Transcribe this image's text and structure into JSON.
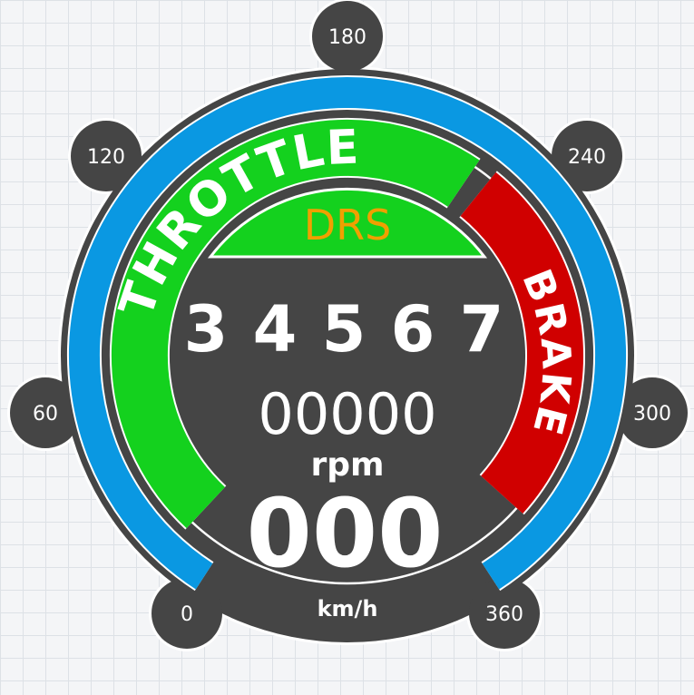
{
  "colors": {
    "body": "#454545",
    "speed_arc": "#0a98e2",
    "throttle": "#14d11e",
    "brake": "#d00000",
    "drs_text": "#f0a000",
    "text": "#ffffff"
  },
  "speed_scale": {
    "unit": "km/h",
    "ticks": [
      "0",
      "60",
      "120",
      "180",
      "240",
      "300",
      "360"
    ],
    "value": 0
  },
  "throttle": {
    "label": "THROTTLE",
    "level": 1.0
  },
  "brake": {
    "label": "BRAKE",
    "level": 1.0
  },
  "drs": {
    "label": "DRS",
    "active": true
  },
  "gears": [
    "3",
    "4",
    "5",
    "6",
    "7"
  ],
  "rpm": {
    "value": "00000",
    "unit": "rpm"
  },
  "speed": {
    "value": "000",
    "unit": "km/h"
  }
}
